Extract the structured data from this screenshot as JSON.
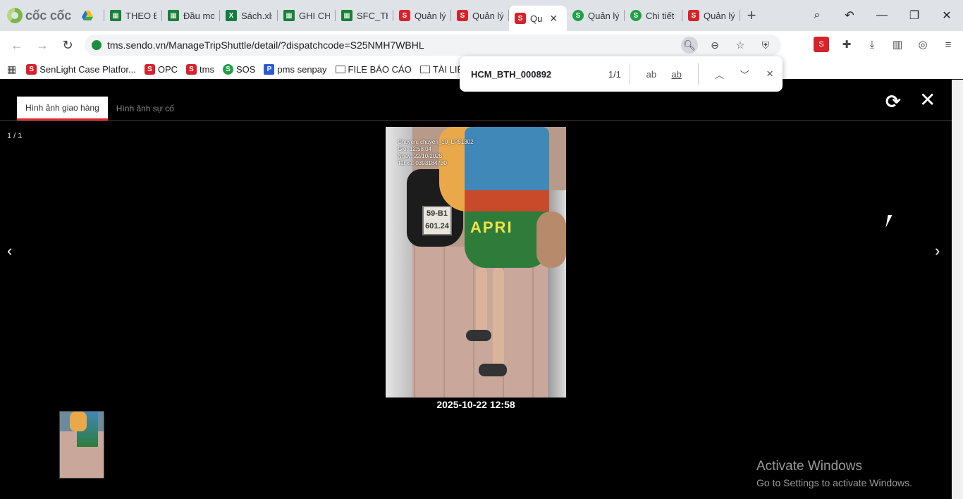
{
  "browser": {
    "brand": "cốc cốc",
    "tabs": [
      {
        "label": "",
        "icon": "drive"
      },
      {
        "label": "THEO Đ",
        "icon": "sheet"
      },
      {
        "label": "Đầu mơ",
        "icon": "sheet"
      },
      {
        "label": "Sách.xls",
        "icon": "excel"
      },
      {
        "label": "GHI CH",
        "icon": "sheet"
      },
      {
        "label": "SFC_TH",
        "icon": "sheet"
      },
      {
        "label": "Quản lý",
        "icon": "sendo"
      },
      {
        "label": "Quản lý",
        "icon": "sendo"
      },
      {
        "label": "Qu",
        "icon": "sendo",
        "active": true
      },
      {
        "label": "Quản lý",
        "icon": "green-circle"
      },
      {
        "label": "Chi tiết",
        "icon": "green-circle"
      },
      {
        "label": "Quản lý",
        "icon": "sendo"
      }
    ],
    "url": "tms.sendo.vn/ManageTripShuttle/detail/?dispatchcode=S25NMH7WBHL",
    "bookmarks": [
      {
        "label": "SenLight Case Platfor...",
        "icon": "sendo"
      },
      {
        "label": "OPC",
        "icon": "sendo"
      },
      {
        "label": "tms",
        "icon": "sendo"
      },
      {
        "label": "SOS",
        "icon": "green-circle"
      },
      {
        "label": "pms senpay",
        "icon": "pms"
      },
      {
        "label": "FILE BÁO CÁO",
        "icon": "folder"
      },
      {
        "label": "TÀI LIỆU",
        "icon": "folder"
      }
    ]
  },
  "find": {
    "query": "HCM_BTH_000892",
    "count": "1/1"
  },
  "viewer": {
    "tabs": [
      "Hình ảnh giao hàng",
      "Hình ảnh sự cố"
    ],
    "counter": "1 / 1",
    "photo_overlay": [
      "Chuyen: chuyen_10_LP51302",
      "Gio: 12:58:04",
      "Ngay: 22/10/2025",
      "Tai xe: 0393184730"
    ],
    "plate_text": "59-B1 601.24",
    "dress_text": "APRI",
    "caption": "2025-10-22 12:58"
  },
  "watermark": {
    "title": "Activate Windows",
    "subtitle": "Go to Settings to activate Windows."
  }
}
